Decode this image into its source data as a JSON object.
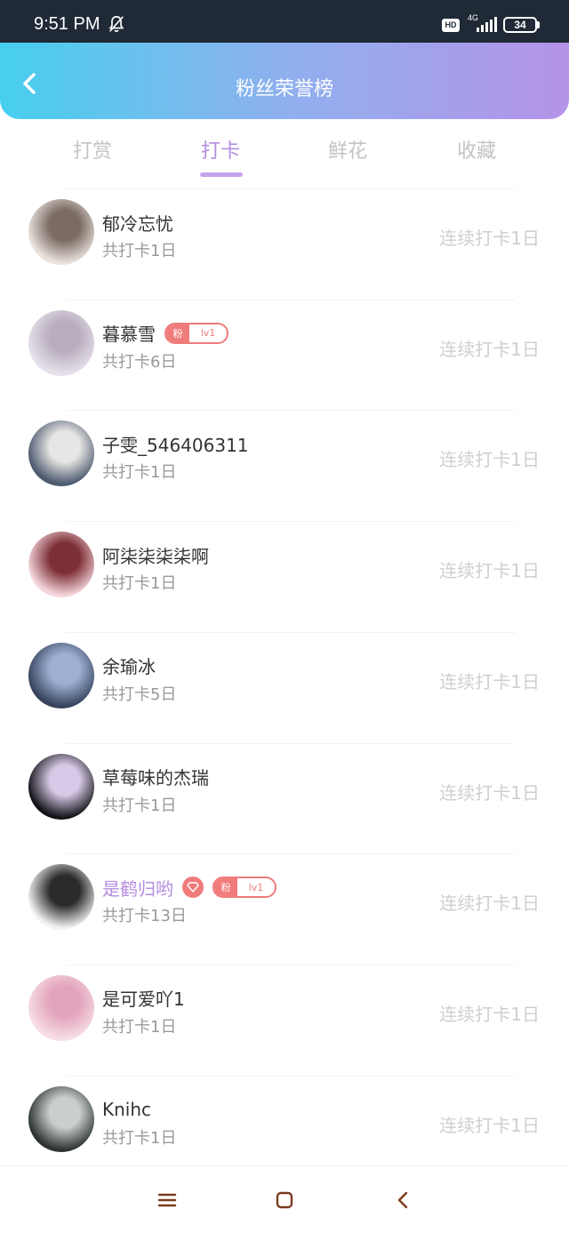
{
  "status_bar": {
    "time": "9:51 PM",
    "hd": "HD",
    "network": "4G",
    "battery": "34"
  },
  "header": {
    "title": "粉丝荣誉榜"
  },
  "tabs": [
    {
      "label": "打赏",
      "active": false
    },
    {
      "label": "打卡",
      "active": true
    },
    {
      "label": "鲜花",
      "active": false
    },
    {
      "label": "收藏",
      "active": false
    }
  ],
  "list": [
    {
      "name": "郁冷忘忧",
      "count": "共打卡1日",
      "streak": "连续打卡1日",
      "vip": false,
      "badge": null
    },
    {
      "name": "暮慕雪",
      "count": "共打卡6日",
      "streak": "连续打卡1日",
      "vip": false,
      "badge": {
        "left": "粉",
        "level": "lv1"
      }
    },
    {
      "name": "子雯_546406311",
      "count": "共打卡1日",
      "streak": "连续打卡1日",
      "vip": false,
      "badge": null
    },
    {
      "name": "阿柒柒柒柒啊",
      "count": "共打卡1日",
      "streak": "连续打卡1日",
      "vip": false,
      "badge": null
    },
    {
      "name": "余瑜冰",
      "count": "共打卡5日",
      "streak": "连续打卡1日",
      "vip": false,
      "badge": null
    },
    {
      "name": "草莓味的杰瑞",
      "count": "共打卡1日",
      "streak": "连续打卡1日",
      "vip": false,
      "badge": null
    },
    {
      "name": "是鹤归哟",
      "count": "共打卡13日",
      "streak": "连续打卡1日",
      "vip": true,
      "badge": {
        "left": "粉",
        "level": "lv1"
      }
    },
    {
      "name": "是可爱吖1",
      "count": "共打卡1日",
      "streak": "连续打卡1日",
      "vip": false,
      "badge": null
    },
    {
      "name": "Knihc",
      "count": "共打卡1日",
      "streak": "连续打卡1日",
      "vip": false,
      "badge": null
    }
  ],
  "avatar_colors": [
    [
      "#e9e2dd",
      "#7a6b63"
    ],
    [
      "#e6e0ea",
      "#b9aebf"
    ],
    [
      "#4c5a70",
      "#e8e6e4"
    ],
    [
      "#f4d6dc",
      "#7d2f36"
    ],
    [
      "#37445c",
      "#9db0d4"
    ],
    [
      "#141418",
      "#d6c8e6"
    ],
    [
      "#f2f2f2",
      "#2b2b2b"
    ],
    [
      "#f7dde6",
      "#e2a4bc"
    ],
    [
      "#2d3330",
      "#c9d0cc"
    ]
  ],
  "colors": {
    "accent": "#b58de0",
    "badge": "#f07b7b"
  },
  "nav_icons": [
    "menu-icon",
    "home-square-icon",
    "back-chevron-icon"
  ]
}
